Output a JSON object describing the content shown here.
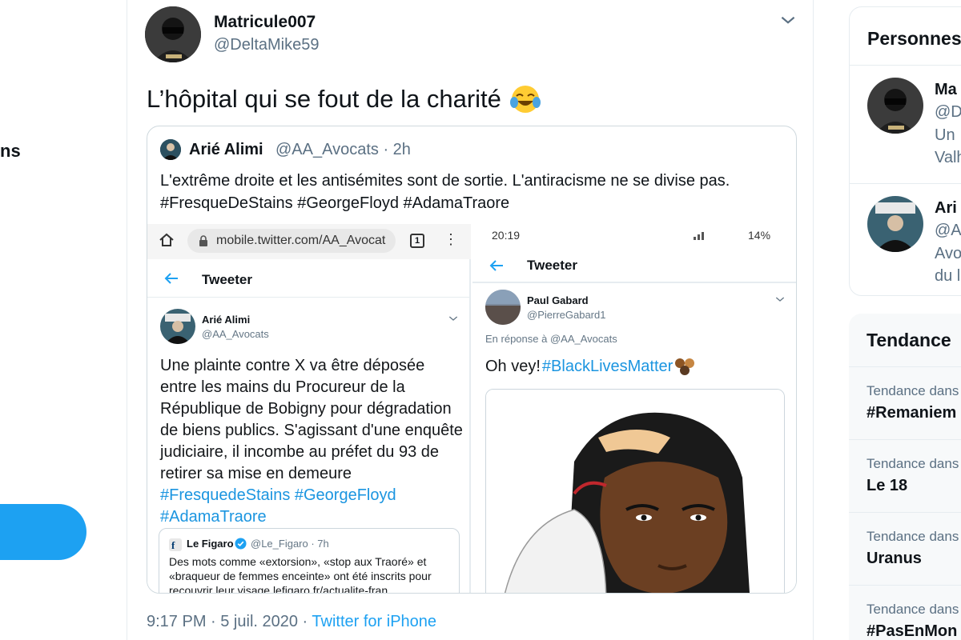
{
  "nav": {
    "partial_label": "ns"
  },
  "tweet": {
    "author_name": "Matricule007",
    "author_handle": "@DeltaMike59",
    "text": "L’hôpital qui se fout de la charité",
    "emoji_icon": "tears-of-joy-emoji",
    "timestamp": "9:17 PM · 5 juil. 2020 · ",
    "source": "Twitter for iPhone"
  },
  "quoted": {
    "name": "Arié Alimi",
    "handle": "@AA_Avocats · 2h",
    "text_line1": "L'extrême droite et les antisémites sont de sortie. L'antiracisme ne se divise pas.",
    "text_line2": "#FresqueDeStains #GeorgeFloyd #AdamaTraore"
  },
  "screenshot_left": {
    "url": "mobile.twitter.com/AA_Avocat",
    "tab_count": "1",
    "header_title": "Tweeter",
    "author_name": "Arié Alimi",
    "author_handle": "@AA_Avocats",
    "body": "Une plainte contre X va être déposée entre les mains du Procureur de la République de Bobigny pour dégradation de biens publics. S'agissant d'une enquête judiciaire, il incombe au préfet du 93 de retirer sa mise en demeure",
    "hashtags_line1": "#FresquedeStains #GeorgeFloyd",
    "hashtags_line2": "#AdamaTraore",
    "inner_quote": {
      "name": "Le Figaro",
      "handle": "@Le_Figaro · 7h",
      "text": "Des mots comme «extorsion», «stop aux Traoré» et «braqueur de femmes enceinte» ont été inscrits pour recouvrir leur visage lefigaro.fr/actualite-fran..."
    }
  },
  "screenshot_right": {
    "status_time": "20:19",
    "status_battery": "14%",
    "header_title": "Tweeter",
    "author_name": "Paul Gabard",
    "author_handle": "@PierreGabard1",
    "reply_to": "En réponse à @AA_Avocats",
    "body_prefix": "Oh vey! ",
    "body_hashtag": "#BlackLivesMatter"
  },
  "sidebar": {
    "who_to_follow_title": "Personnes",
    "people": [
      {
        "name": "Ma",
        "handle": "@D",
        "bio_line1": "Un",
        "bio_line2": "Valh"
      },
      {
        "name": "Ari",
        "handle": "@A",
        "bio_line1": "Avo",
        "bio_line2": "du l"
      }
    ],
    "trends_title": "Tendance",
    "trends": [
      {
        "context": "Tendance dans",
        "name": "#Remaniem"
      },
      {
        "context": "Tendance dans",
        "name": "Le 18"
      },
      {
        "context": "Tendance dans",
        "name": "Uranus"
      },
      {
        "context": "Tendance dans",
        "name": "#PasEnMon"
      }
    ]
  },
  "colors": {
    "accent": "#1da1f2",
    "link_mobile": "#1b95e0",
    "secondary_text": "#5b7083",
    "border": "#e6ecf0"
  }
}
